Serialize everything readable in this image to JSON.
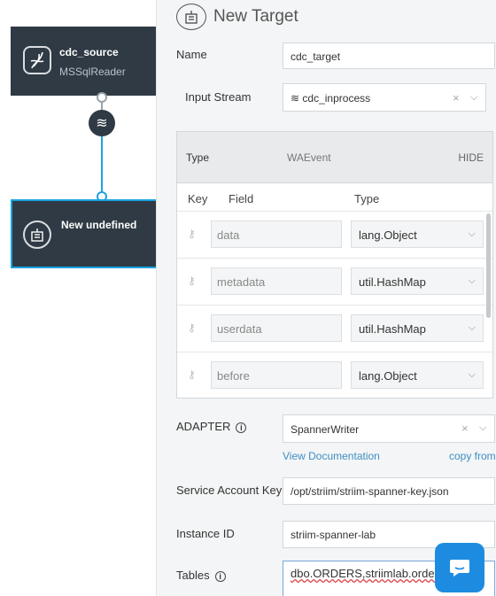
{
  "canvas": {
    "source_node": {
      "title": "cdc_source",
      "subtitle": "MSSqlReader"
    },
    "target_node": {
      "title": "New undefined"
    },
    "stream_icon": "waves-icon"
  },
  "panel": {
    "header_title": "New Target",
    "name": {
      "label": "Name",
      "value": "cdc_target"
    },
    "input_stream": {
      "label": "Input Stream",
      "value": "cdc_inprocess",
      "glyph": "≋",
      "clear": "×"
    },
    "type_section": {
      "type_label": "Type",
      "type_value": "WAEvent",
      "hide_label": "HIDE",
      "columns": {
        "key": "Key",
        "field": "Field",
        "type": "Type"
      },
      "rows": [
        {
          "field": "data",
          "type": "lang.Object"
        },
        {
          "field": "metadata",
          "type": "util.HashMap"
        },
        {
          "field": "userdata",
          "type": "util.HashMap"
        },
        {
          "field": "before",
          "type": "lang.Object"
        }
      ]
    },
    "adapter": {
      "label": "ADAPTER",
      "value": "SpannerWriter",
      "clear": "×",
      "view_docs": "View Documentation",
      "copy_from": "copy from"
    },
    "service_account_key": {
      "label": "Service Account Key",
      "value": "/opt/striim/striim-spanner-key.json"
    },
    "instance_id": {
      "label": "Instance ID",
      "value": "striim-spanner-lab"
    },
    "tables": {
      "label": "Tables",
      "value": "dbo.ORDERS,striimlab.orders"
    }
  },
  "colors": {
    "node_bg": "#2f3a44",
    "accent": "#1aa3e0",
    "link": "#3d8fc4",
    "chat": "#1d8ce0"
  }
}
